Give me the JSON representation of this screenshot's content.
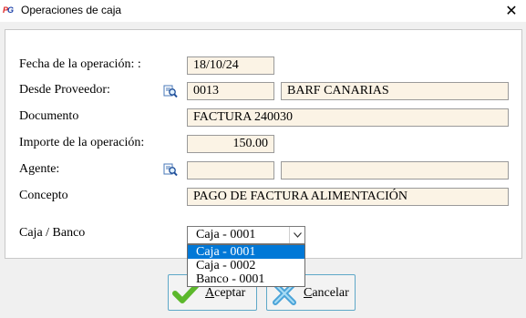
{
  "window": {
    "app_icon_left": "P",
    "app_icon_right": "G",
    "title": "Operaciones de caja",
    "close": "✕"
  },
  "form": {
    "fecha_label": "Fecha de la operación: :",
    "fecha_value": "18/10/24",
    "proveedor_label": "Desde Proveedor:",
    "proveedor_code": "0013",
    "proveedor_name": "BARF CANARIAS",
    "documento_label": "Documento",
    "documento_value": "FACTURA 240030",
    "importe_label": "Importe de la operación:",
    "importe_value": "150.00",
    "agente_label": "Agente:",
    "agente_code": "",
    "agente_name": "",
    "concepto_label": "Concepto",
    "concepto_value": "PAGO DE FACTURA ALIMENTACIÓN",
    "caja_label": "Caja / Banco",
    "caja_selected": "Caja - 0001",
    "caja_options": [
      "Caja - 0001",
      "Caja - 0002",
      "Banco - 0001"
    ]
  },
  "buttons": {
    "accept_underlined": "A",
    "accept_rest": "ceptar",
    "cancel_underlined": "C",
    "cancel_rest": "ancelar"
  },
  "colors": {
    "field_bg": "#fbf3e5",
    "highlight": "#0078d7",
    "accept_icon": "#5cb82c",
    "cancel_icon": "#4aa3d8"
  },
  "icons": [
    "app-logo-icon",
    "close-icon",
    "lookup-magnifier-icon",
    "chevron-down-icon",
    "checkmark-icon",
    "cancel-x-icon"
  ]
}
